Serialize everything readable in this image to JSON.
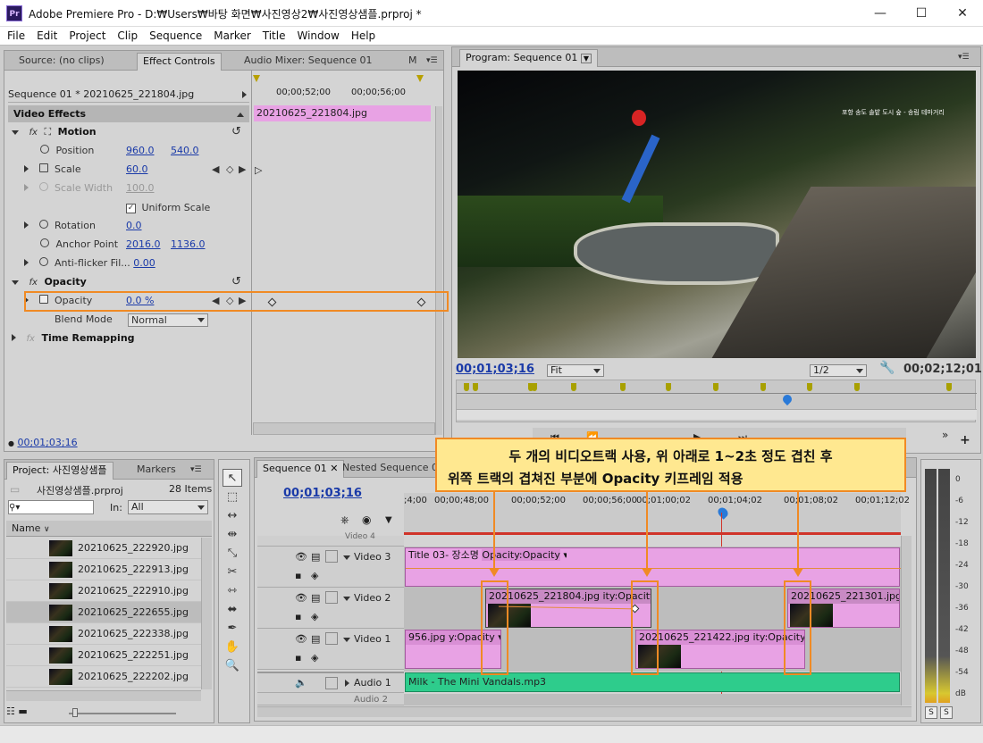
{
  "app": {
    "logo": "Pr",
    "title": "Adobe Premiere Pro - D:₩Users₩바탕 화면₩사진영상2₩사진영상샘플.prproj *"
  },
  "window_controls": {
    "minimize": "—",
    "maximize": "☐",
    "close": "✕"
  },
  "menu": [
    "File",
    "Edit",
    "Project",
    "Clip",
    "Sequence",
    "Marker",
    "Title",
    "Window",
    "Help"
  ],
  "source_panel": {
    "tabs": [
      "Source: (no clips)",
      "Effect Controls",
      "Audio Mixer: Sequence 01",
      "M"
    ],
    "sequence_label": "Sequence 01 * 20210625_221804.jpg",
    "time1": "00;00;52;00",
    "time2": "00;00;56;00",
    "clip_name": "20210625_221804.jpg",
    "video_effects": "Video Effects",
    "motion": "Motion",
    "position_label": "Position",
    "position_x": "960.0",
    "position_y": "540.0",
    "scale_label": "Scale",
    "scale_value": "60.0",
    "scale_width_label": "Scale Width",
    "scale_width_value": "100.0",
    "uniform_scale": "Uniform Scale",
    "rotation_label": "Rotation",
    "rotation_value": "0.0",
    "anchor_label": "Anchor Point",
    "anchor_x": "2016.0",
    "anchor_y": "1136.0",
    "antiflicker_label": "Anti-flicker Fil...",
    "antiflicker_value": "0.00",
    "opacity_group": "Opacity",
    "opacity_label": "Opacity",
    "opacity_value": "0.0 %",
    "blend_label": "Blend Mode",
    "blend_value": "Normal",
    "time_remap": "Time Remapping",
    "timecode": "00;01;03;16"
  },
  "program": {
    "tab": "Program: Sequence 01",
    "overlay_text": "포항 송도 솔밭 도시 숲 - 송림 테마거리",
    "timecode": "00;01;03;16",
    "fit": "Fit",
    "quality": "1/2",
    "duration": "00;02;12;01"
  },
  "project": {
    "tabs": [
      "Project: 사진영상샘플",
      "Markers"
    ],
    "file": "사진영상샘플.prproj",
    "items_count": "28 Items",
    "in_label": "In:",
    "in_value": "All",
    "col_name": "Name",
    "items": [
      "20210625_222920.jpg",
      "20210625_222913.jpg",
      "20210625_222910.jpg",
      "20210625_222655.jpg",
      "20210625_222338.jpg",
      "20210625_222251.jpg",
      "20210625_222202.jpg"
    ]
  },
  "timeline": {
    "tabs": [
      "Sequence 01",
      "Nested Sequence 01"
    ],
    "timecode": "00;01;03;16",
    "ruler": [
      ";4;00",
      "00;00;48;00",
      "00;00;52;00",
      "00;00;56;00",
      "00;01;00;02",
      "00;01;04;02",
      "00;01;08;02",
      "00;01;12;02"
    ],
    "tracks": {
      "v4": "Video 4",
      "v3": "Video 3",
      "v2": "Video 2",
      "v1": "Video 1",
      "a1": "Audio 1",
      "a2": "Audio 2"
    },
    "clips": {
      "v3": "Title 03- 장소명",
      "v3_fx": "Opacity:Opacity",
      "v2a": "20210625_221804.jpg",
      "v2a_fx": "ity:Opacity",
      "v2b": "20210625_221301.jpg",
      "v2b_tail": "ity",
      "v1a": "956.jpg",
      "v1a_fx": "y:Opacity",
      "v1b": "20210625_221422.jpg",
      "v1b_fx": "ity:Opacity",
      "a1": "Milk - The Mini Vandals.mp3"
    }
  },
  "annotation": {
    "line1": "두 개의 비디오트랙 사용, 위 아래로 1~2초 정도 겹친 후",
    "line2": "위쪽 트랙의 겹쳐진 부분에 Opacity 키프레임 적용"
  },
  "audio_meter": {
    "labels": [
      "0",
      "-6",
      "-12",
      "-18",
      "-24",
      "-30",
      "-36",
      "-42",
      "-48",
      "-54",
      "dB"
    ],
    "solo": "S"
  },
  "colors": {
    "accent": "#f08a24",
    "clip": "#e8a2e4",
    "audio_clip": "#2ecc8c",
    "timecode": "#1a3aa8",
    "playhead": "#d0342a"
  }
}
